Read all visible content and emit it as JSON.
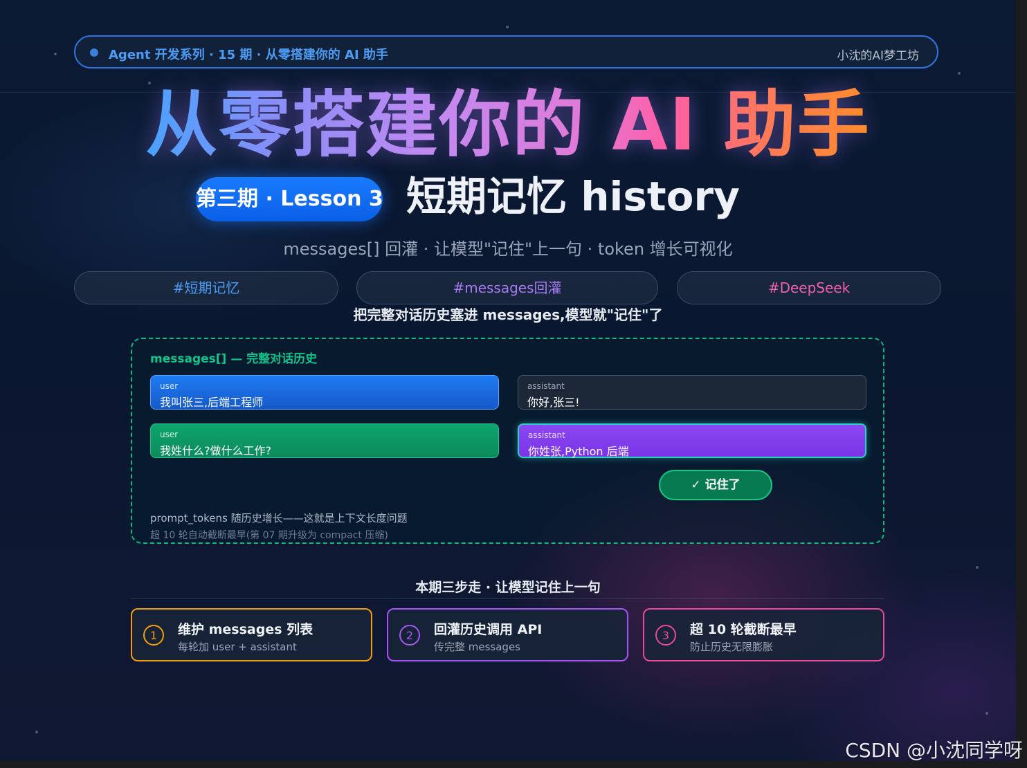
{
  "header": {
    "series_label": "Agent 开发系列 · 15 期 · 从零搭建你的 AI 助手",
    "author": "小沈的AI梦工坊"
  },
  "hero": {
    "title": "从零搭建你的 AI 助手",
    "lesson_badge": "第三期 · Lesson 3",
    "lesson_title": "短期记忆 history",
    "subtitle": "messages[] 回灌 · 让模型\"记住\"上一句 · token 增长可视化"
  },
  "tags": [
    {
      "label": "#短期记忆",
      "color": "#4b9cf5"
    },
    {
      "label": "#messages回灌",
      "color": "#a77cf2"
    },
    {
      "label": "#DeepSeek",
      "color": "#f05fb0"
    }
  ],
  "diagram": {
    "caption": "把完整对话历史塞进 messages,模型就\"记住\"了",
    "title": "messages[] — 完整对话历史",
    "messages": [
      {
        "role": "user",
        "text": "我叫张三,后端工程师"
      },
      {
        "role": "assistant",
        "text": "你好,张三!"
      },
      {
        "role": "user",
        "text": "我姓什么?做什么工作?"
      },
      {
        "role": "assistant",
        "text": "你姓张,Python 后端"
      }
    ],
    "remember_label": "✓ 记住了",
    "note_primary": "prompt_tokens 随历史增长——这就是上下文长度问题",
    "note_secondary": "超 10 轮自动截断最早(第 07 期升级为 compact 压缩)"
  },
  "steps": {
    "title": "本期三步走 · 让模型记住上一句",
    "items": [
      {
        "num": "1",
        "title": "维护 messages 列表",
        "desc": "每轮加 user + assistant",
        "color": "#f59e0b"
      },
      {
        "num": "2",
        "title": "回灌历史调用 API",
        "desc": "传完整 messages",
        "color": "#a855f7"
      },
      {
        "num": "3",
        "title": "超 10 轮截断最早",
        "desc": "防止历史无限膨胀",
        "color": "#ec4899"
      }
    ]
  },
  "watermark": "CSDN @小沈同学呀",
  "colors": {
    "accent_blue": "#2f74e0",
    "accent_green": "#10b981"
  }
}
